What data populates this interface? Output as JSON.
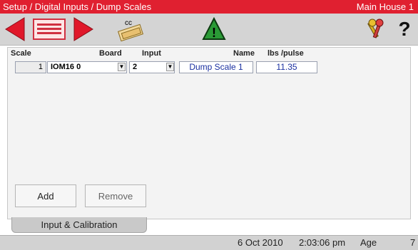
{
  "title_bar": {
    "breadcrumb": "Setup / Digital Inputs / Dump Scales",
    "house": "Main House 1"
  },
  "toolbar": {
    "icons": [
      "prev-arrow-icon",
      "list-view-icon",
      "next-arrow-icon",
      "copy-cc-icon",
      "warning-icon",
      "keys-icon",
      "help-icon"
    ],
    "cc_label": "cc",
    "warning_glyph": "!",
    "help_glyph": "?"
  },
  "table": {
    "headers": {
      "scale": "Scale",
      "board": "Board",
      "input": "Input",
      "name": "Name",
      "lbs_per_pulse": "lbs /pulse"
    },
    "rows": [
      {
        "scale": "1",
        "board": "IOM16 0",
        "input": "2",
        "name": "Dump Scale 1",
        "lbs_per_pulse": "11.35"
      }
    ]
  },
  "buttons": {
    "add": "Add",
    "remove": "Remove"
  },
  "tab": {
    "label": "Input & Calibration"
  },
  "status_bar": {
    "date": "6 Oct 2010",
    "time": "2:03:06 pm",
    "age_label": "Age",
    "age_value": "7"
  },
  "colors": {
    "title_red": "#e02030",
    "arrow_red": "#e0182a",
    "warning_green": "#2a9a36",
    "link_blue": "#1a2fa0"
  }
}
